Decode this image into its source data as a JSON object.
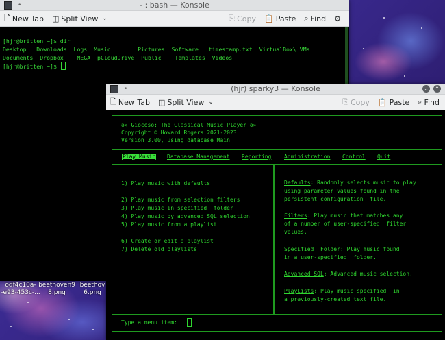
{
  "bash_window": {
    "title": "- : bash — Konsole",
    "toolbar": {
      "new_tab": "New Tab",
      "split_view": "Split View",
      "copy": "Copy",
      "paste": "Paste",
      "find": "Find"
    },
    "lines": [
      "[hjr@britten ~]$ dir",
      "Desktop   Downloads  Logs  Music        Pictures  Software   timestamp.txt  VirtualBox\\ VMs",
      "Documents  Dropbox    MEGA  pCloudDrive  Public    Templates  Videos",
      "[hjr@britten ~]$ "
    ]
  },
  "sparky_window": {
    "title": "(hjr) sparky3 — Konsole",
    "toolbar": {
      "new_tab": "New Tab",
      "split_view": "Split View",
      "copy": "Copy",
      "paste": "Paste",
      "find": "Find"
    }
  },
  "giocoso": {
    "banner": [
      "ə» Giocoso: The Classical Music Player ə»",
      "Copyright © Howard Rogers 2021-2023",
      "Version 3.00, using database Main"
    ],
    "menu": [
      "Play Music",
      "Database Management",
      "Reporting",
      "Administration",
      "Control",
      "Quit"
    ],
    "options": [
      "1) Play music with defaults",
      "",
      "2) Play music from selection filters",
      "3) Play music in specified  folder",
      "4) Play music by advanced SQL selection",
      "5) Play music from a playlist",
      "",
      "6) Create or edit a playlist",
      "7) Delete old playlists"
    ],
    "help": [
      {
        "term": "Defaults",
        "lines": [
          ": Randomly selects music to play",
          "using parameter values found in the",
          "persistent configuration  file."
        ]
      },
      {
        "term": "Filters",
        "lines": [
          ": Play music that matches any",
          "of a number of user-specified  filter",
          "values."
        ]
      },
      {
        "term": "Specified  Folder",
        "lines": [
          ": Play music found",
          "in a user-specified  folder."
        ]
      },
      {
        "term": "Advanced SQL",
        "lines": [
          ": Advanced music selection."
        ]
      },
      {
        "term": "Playlists",
        "lines": [
          ": Play music specified  in",
          "a previously-created text file."
        ]
      }
    ],
    "prompt": "Type a menu item:"
  },
  "desktop_icons": [
    {
      "line1": "odf4c10a-",
      "line2": "-e93-453c-..."
    },
    {
      "line1": "beethoven9",
      "line2": "8.png"
    },
    {
      "line1": "beethov",
      "line2": "6.png"
    }
  ],
  "icons": {
    "new_tab": "new-tab-icon",
    "split_view": "split-view-icon",
    "copy": "copy-icon",
    "paste": "paste-icon",
    "find": "find-icon",
    "settings": "settings-icon"
  }
}
